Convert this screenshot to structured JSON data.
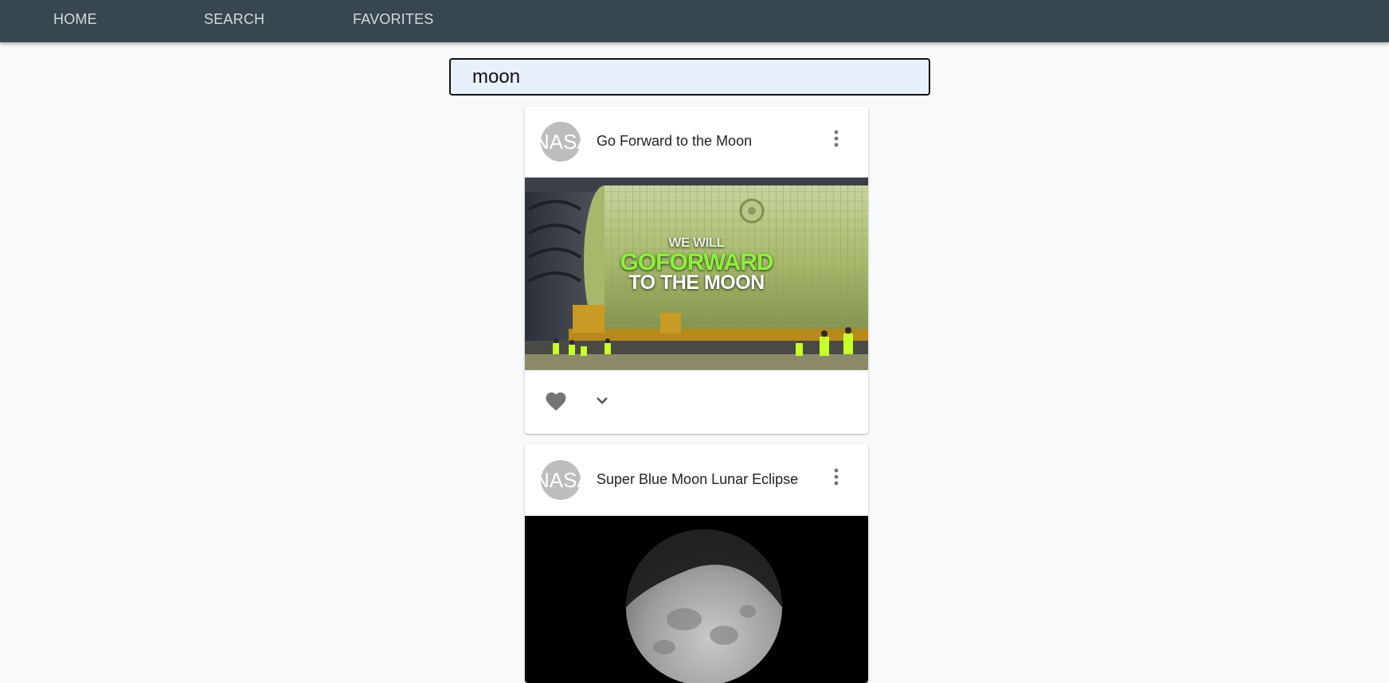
{
  "nav": {
    "items": [
      {
        "label": "HOME"
      },
      {
        "label": "SEARCH"
      },
      {
        "label": "FAVORITES"
      }
    ]
  },
  "search": {
    "value": "moon"
  },
  "cards": [
    {
      "avatar_text": "NASA",
      "title": "Go Forward to the Moon",
      "image_overlay": [
        "WE WILL",
        "GOFORWARD",
        "TO THE MOON"
      ],
      "icons": {
        "more": "more-vert-icon",
        "like": "heart-icon",
        "expand": "chevron-down-icon"
      }
    },
    {
      "avatar_text": "NASA",
      "title": "Super Blue Moon Lunar Eclipse",
      "icons": {
        "more": "more-vert-icon"
      }
    }
  ],
  "colors": {
    "navbar": "#37474f",
    "nav_text": "#d6dadc",
    "page_bg": "#f7f9fa",
    "search_bg": "#e8f0fe",
    "avatar_bg": "#bdbdbd",
    "icon": "#757575",
    "overlay_green": "#8cf03a"
  }
}
